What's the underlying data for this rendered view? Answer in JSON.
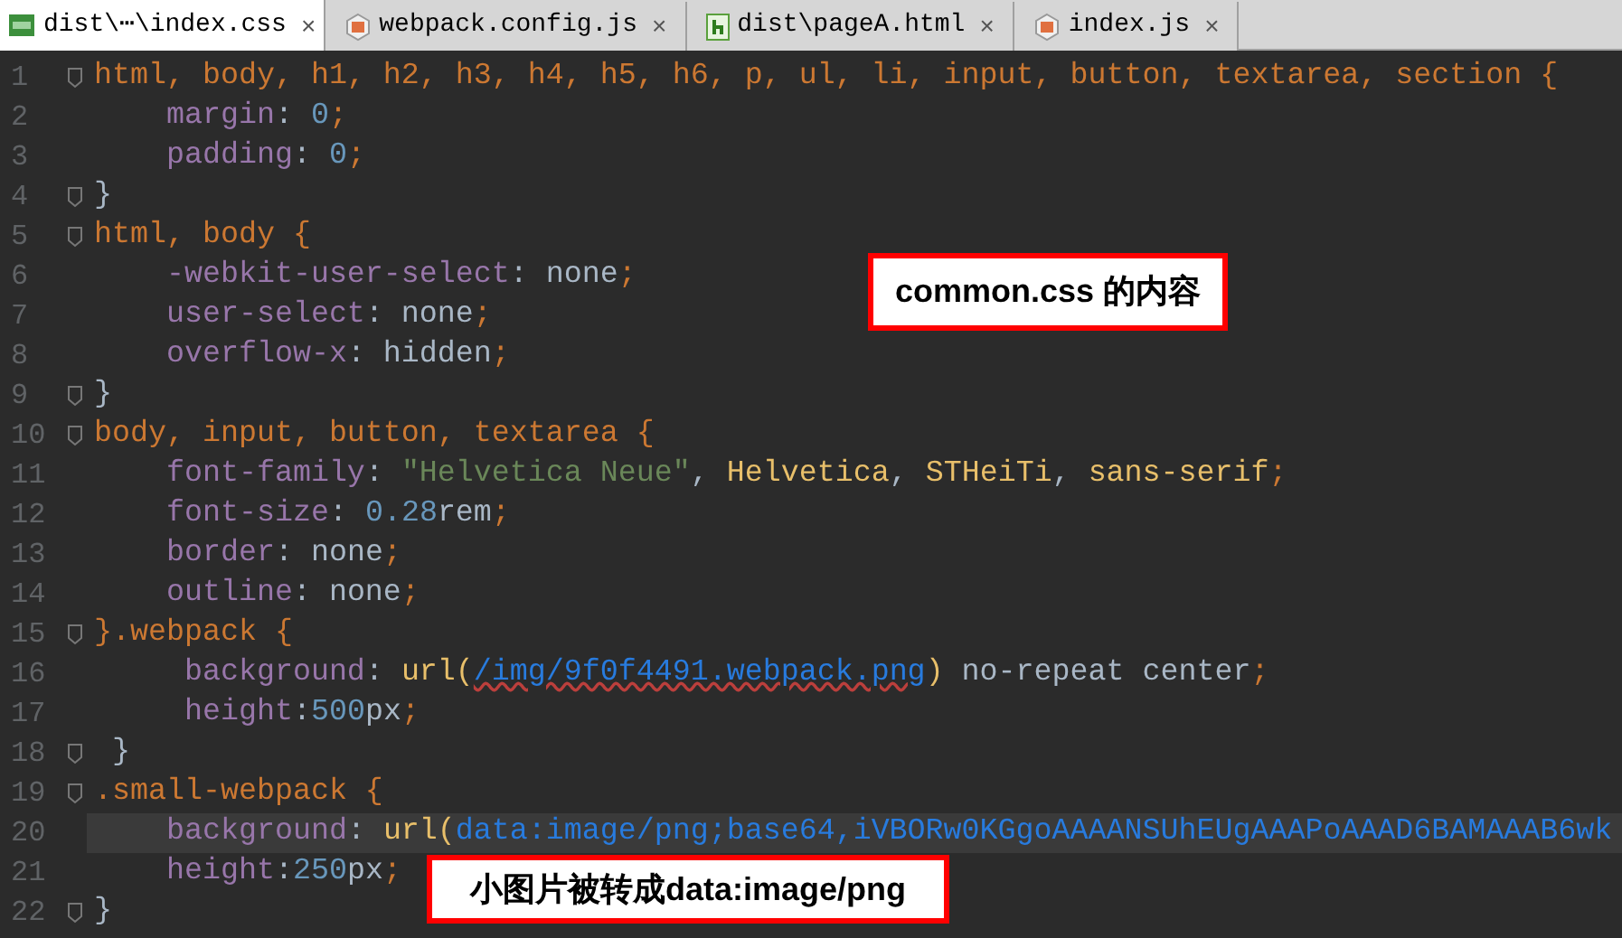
{
  "tabs": [
    {
      "label": "dist\\⋯\\index.css",
      "selected": true,
      "kind": "css",
      "close": "×"
    },
    {
      "label": "webpack.config.js",
      "selected": false,
      "kind": "js",
      "close": "×"
    },
    {
      "label": "dist\\pageA.html",
      "selected": false,
      "kind": "html",
      "close": "×"
    },
    {
      "label": "index.js",
      "selected": false,
      "kind": "js",
      "close": "×"
    }
  ],
  "lines": [
    {
      "number": "1",
      "fold": true,
      "current": false,
      "tokens": [
        {
          "t": "html, body, h1, h2, h3, h4, h5, h6, p, ul, li, input, button, textarea, section {",
          "kind": "sel"
        }
      ]
    },
    {
      "number": "2",
      "fold": false,
      "current": false,
      "tokens": [
        {
          "t": "    margin",
          "kind": "prop"
        },
        {
          "t": ": ",
          "kind": "text"
        },
        {
          "t": "0",
          "kind": "num"
        },
        {
          "t": ";",
          "kind": "semi"
        }
      ]
    },
    {
      "number": "3",
      "fold": false,
      "current": false,
      "tokens": [
        {
          "t": "    padding",
          "kind": "prop"
        },
        {
          "t": ": ",
          "kind": "text"
        },
        {
          "t": "0",
          "kind": "num"
        },
        {
          "t": ";",
          "kind": "semi"
        }
      ]
    },
    {
      "number": "4",
      "fold": true,
      "current": false,
      "tokens": [
        {
          "t": "}",
          "kind": "text"
        }
      ]
    },
    {
      "number": "5",
      "fold": true,
      "current": false,
      "tokens": [
        {
          "t": "html, body {",
          "kind": "sel"
        }
      ]
    },
    {
      "number": "6",
      "fold": false,
      "current": false,
      "tokens": [
        {
          "t": "    -webkit-user-select",
          "kind": "prop"
        },
        {
          "t": ": none",
          "kind": "text"
        },
        {
          "t": ";",
          "kind": "semi"
        }
      ]
    },
    {
      "number": "7",
      "fold": false,
      "current": false,
      "tokens": [
        {
          "t": "    user-select",
          "kind": "prop"
        },
        {
          "t": ": none",
          "kind": "text"
        },
        {
          "t": ";",
          "kind": "semi"
        }
      ]
    },
    {
      "number": "8",
      "fold": false,
      "current": false,
      "tokens": [
        {
          "t": "    overflow-x",
          "kind": "prop"
        },
        {
          "t": ": hidden",
          "kind": "text"
        },
        {
          "t": ";",
          "kind": "semi"
        }
      ]
    },
    {
      "number": "9",
      "fold": true,
      "current": false,
      "tokens": [
        {
          "t": "}",
          "kind": "text"
        }
      ]
    },
    {
      "number": "10",
      "fold": true,
      "current": false,
      "tokens": [
        {
          "t": "body, input, button, textarea {",
          "kind": "sel"
        }
      ]
    },
    {
      "number": "11",
      "fold": false,
      "current": false,
      "tokens": [
        {
          "t": "    font-family",
          "kind": "prop"
        },
        {
          "t": ": ",
          "kind": "text"
        },
        {
          "t": "\"Helvetica Neue\"",
          "kind": "str"
        },
        {
          "t": ", ",
          "kind": "text"
        },
        {
          "t": "Helvetica",
          "kind": "font"
        },
        {
          "t": ", ",
          "kind": "text"
        },
        {
          "t": "STHeiTi",
          "kind": "font"
        },
        {
          "t": ", ",
          "kind": "text"
        },
        {
          "t": "sans-serif",
          "kind": "font"
        },
        {
          "t": ";",
          "kind": "semi"
        }
      ]
    },
    {
      "number": "12",
      "fold": false,
      "current": false,
      "tokens": [
        {
          "t": "    font-size",
          "kind": "prop"
        },
        {
          "t": ": ",
          "kind": "text"
        },
        {
          "t": "0.28",
          "kind": "num"
        },
        {
          "t": "rem",
          "kind": "text"
        },
        {
          "t": ";",
          "kind": "semi"
        }
      ]
    },
    {
      "number": "13",
      "fold": false,
      "current": false,
      "tokens": [
        {
          "t": "    border",
          "kind": "prop"
        },
        {
          "t": ": none",
          "kind": "text"
        },
        {
          "t": ";",
          "kind": "semi"
        }
      ]
    },
    {
      "number": "14",
      "fold": false,
      "current": false,
      "tokens": [
        {
          "t": "    outline",
          "kind": "prop"
        },
        {
          "t": ": none",
          "kind": "text"
        },
        {
          "t": ";",
          "kind": "semi"
        }
      ]
    },
    {
      "number": "15",
      "fold": true,
      "current": false,
      "tokens": [
        {
          "t": "}.webpack {",
          "kind": "sel"
        }
      ]
    },
    {
      "number": "16",
      "fold": false,
      "current": false,
      "tokens": [
        {
          "t": "     background",
          "kind": "prop"
        },
        {
          "t": ": ",
          "kind": "text"
        },
        {
          "t": "url(",
          "kind": "font"
        },
        {
          "t": "/img/9f0f4491.webpack.png",
          "kind": "url_wavy"
        },
        {
          "t": ")",
          "kind": "font"
        },
        {
          "t": " no-repeat center",
          "kind": "text"
        },
        {
          "t": ";",
          "kind": "semi"
        }
      ]
    },
    {
      "number": "17",
      "fold": false,
      "current": false,
      "tokens": [
        {
          "t": "     height",
          "kind": "prop"
        },
        {
          "t": ":",
          "kind": "text"
        },
        {
          "t": "500",
          "kind": "num"
        },
        {
          "t": "px",
          "kind": "text"
        },
        {
          "t": ";",
          "kind": "semi"
        }
      ]
    },
    {
      "number": "18",
      "fold": true,
      "current": false,
      "tokens": [
        {
          "t": " }",
          "kind": "text"
        }
      ]
    },
    {
      "number": "19",
      "fold": true,
      "current": false,
      "tokens": [
        {
          "t": ".small-webpack {",
          "kind": "sel"
        }
      ]
    },
    {
      "number": "20",
      "fold": false,
      "current": true,
      "tokens": [
        {
          "t": "    background",
          "kind": "prop"
        },
        {
          "t": ": ",
          "kind": "text"
        },
        {
          "t": "url(",
          "kind": "font"
        },
        {
          "t": "data:image/png;base64,iVBORw0KGgoAAAANSUhEUgAAAPoAAAD6BAMAAAB6wk",
          "kind": "url"
        }
      ]
    },
    {
      "number": "21",
      "fold": false,
      "current": false,
      "tokens": [
        {
          "t": "    height",
          "kind": "prop"
        },
        {
          "t": ":",
          "kind": "text"
        },
        {
          "t": "250",
          "kind": "num"
        },
        {
          "t": "px",
          "kind": "text"
        },
        {
          "t": ";",
          "kind": "semi"
        }
      ]
    },
    {
      "number": "22",
      "fold": true,
      "current": false,
      "tokens": [
        {
          "t": "}",
          "kind": "text"
        }
      ]
    }
  ],
  "annotations": [
    "common.css 的内容",
    "小图片被转成data:image/png"
  ]
}
